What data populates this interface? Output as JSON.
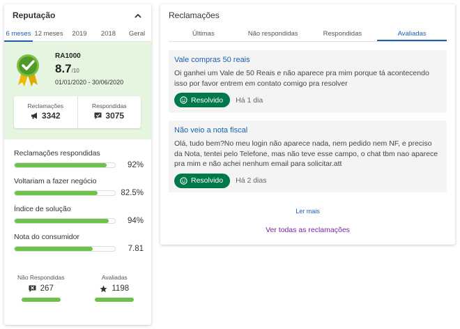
{
  "reputation": {
    "title": "Reputação",
    "periods": [
      "6 meses",
      "12 meses",
      "2019",
      "2018",
      "Geral"
    ],
    "active_period": 0,
    "name": "RA1000",
    "score": "8.7",
    "score_max": "/10",
    "dates": "01/01/2020 - 30/06/2020",
    "counts": [
      {
        "label": "Reclamações",
        "value": "3342",
        "icon": "megaphone-icon"
      },
      {
        "label": "Respondidas",
        "value": "3075",
        "icon": "chat-icon"
      }
    ],
    "metrics": [
      {
        "label": "Reclamações respondidas",
        "value": "92%",
        "fraction": 0.92
      },
      {
        "label": "Voltariam a fazer negócio",
        "value": "82.5%",
        "fraction": 0.825
      },
      {
        "label": "Índice de solução",
        "value": "94%",
        "fraction": 0.94
      },
      {
        "label": "Nota do consumidor",
        "value": "7.81",
        "fraction": 0.781
      }
    ],
    "bottom": [
      {
        "label": "Não Respondidas",
        "value": "267",
        "icon": "chat-x-icon"
      },
      {
        "label": "Avaliadas",
        "value": "1198",
        "icon": "star-icon"
      }
    ],
    "colors": {
      "accent": "#1a5fb4",
      "green_bg": "#e6f5df",
      "bar": "#6cc24a"
    }
  },
  "complaints": {
    "title": "Reclamações",
    "tabs": [
      "Últimas",
      "Não respondidas",
      "Respondidas",
      "Avaliadas"
    ],
    "active_tab": 3,
    "items": [
      {
        "title": "Vale compras 50 reais",
        "body": "Oi ganhei um Vale de 50 Reais e não aparece pra mim porque tá acontecendo isso por favor entrem em contato comigo pra resolver",
        "status": "Resolvido",
        "time": "Há 1 dia"
      },
      {
        "title": "Não veio a nota fiscal",
        "body": "Olá, tudo bem?No meu login não aparece nada, nem pedido nem NF, e preciso da Nota, tentei pelo Telefone, mas não teve esse campo, o chat tbm nao aparece pra mim e não achei nenhum email para solicitar.att",
        "status": "Resolvido",
        "time": "Há 2 dias"
      }
    ],
    "read_more": "Ler mais",
    "see_all": "Ver todas as reclamações",
    "colors": {
      "resolved_badge": "#00794a",
      "see_all": "#7b1fa2"
    }
  }
}
